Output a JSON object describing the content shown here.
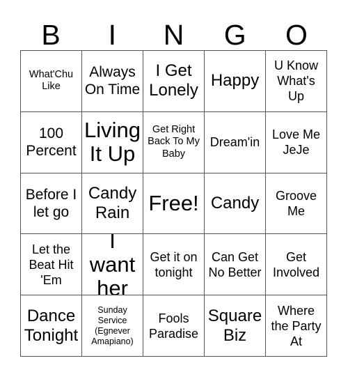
{
  "header": {
    "letters": [
      "B",
      "I",
      "N",
      "G",
      "O"
    ]
  },
  "grid": {
    "rows": 5,
    "columns": 5,
    "border_color": "#555555",
    "background_color": "#ffffff",
    "text_color": "#000000",
    "cells": [
      {
        "text": "What'Chu Like",
        "size": "s-sm"
      },
      {
        "text": "Always On Time",
        "size": "s-lg"
      },
      {
        "text": "I Get Lonely",
        "size": "s-xl"
      },
      {
        "text": "Happy",
        "size": "s-xl"
      },
      {
        "text": "U Know What's Up",
        "size": "s-md"
      },
      {
        "text": "100 Percent",
        "size": "s-lg"
      },
      {
        "text": "Living It Up",
        "size": "s-xxl"
      },
      {
        "text": "Get Right Back To My Baby",
        "size": "s-sm"
      },
      {
        "text": "Dream'in",
        "size": "s-md"
      },
      {
        "text": "Love Me JeJe",
        "size": "s-md"
      },
      {
        "text": "Before I let go",
        "size": "s-lg"
      },
      {
        "text": "Candy Rain",
        "size": "s-xl"
      },
      {
        "text": "Free!",
        "size": "s-xxl"
      },
      {
        "text": "Candy",
        "size": "s-xl"
      },
      {
        "text": "Groove Me",
        "size": "s-md"
      },
      {
        "text": "Let the Beat Hit 'Em",
        "size": "s-md"
      },
      {
        "text": "I want her",
        "size": "s-xxl"
      },
      {
        "text": "Get it on tonight",
        "size": "s-md"
      },
      {
        "text": "Can Get No Better",
        "size": "s-md"
      },
      {
        "text": "Get Involved",
        "size": "s-md"
      },
      {
        "text": "Dance Tonight",
        "size": "s-xl"
      },
      {
        "text": "Sunday Service (Egnever Amapiano)",
        "size": "s-xs"
      },
      {
        "text": "Fools Paradise",
        "size": "s-md"
      },
      {
        "text": "Square Biz",
        "size": "s-xl"
      },
      {
        "text": "Where the Party At",
        "size": "s-md"
      }
    ]
  }
}
